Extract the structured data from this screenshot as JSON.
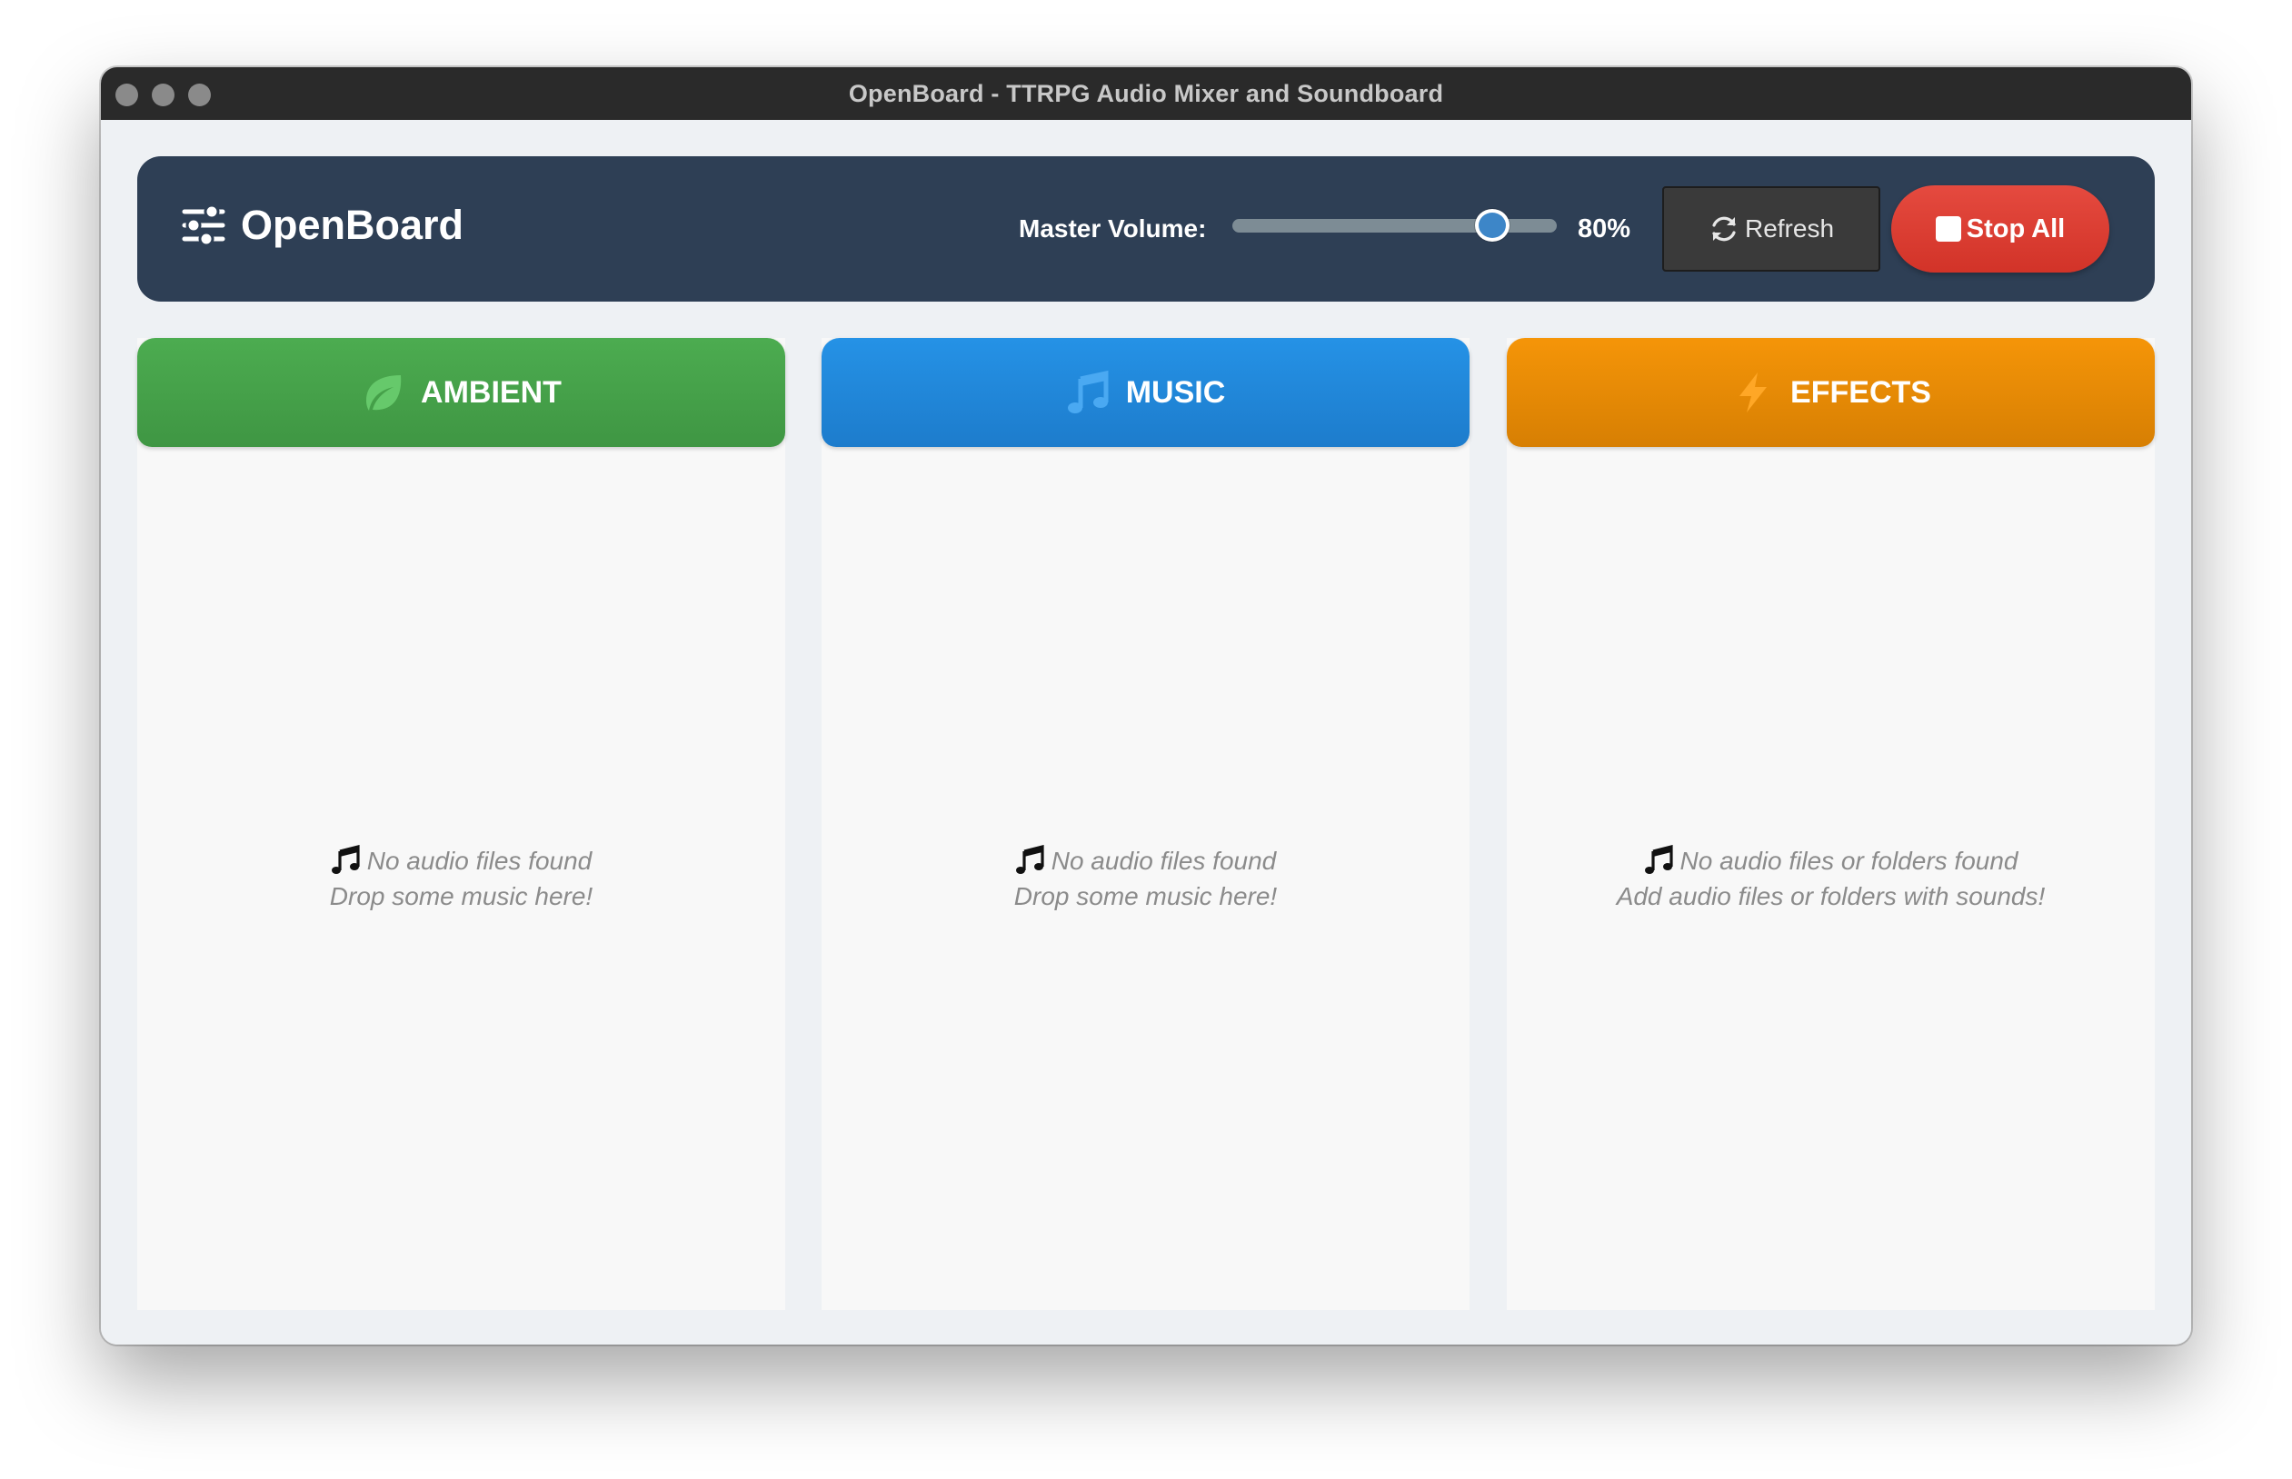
{
  "window": {
    "title": "OpenBoard - TTRPG Audio Mixer and Soundboard"
  },
  "header": {
    "brand": "OpenBoard",
    "brand_icon": "sliders-icon",
    "volume_label": "Master Volume:",
    "volume_value": "80%",
    "volume_level": 0.8,
    "refresh_label": "Refresh",
    "stop_label": "Stop All",
    "colors": {
      "header_bg": "#2e3f55",
      "stop": "#d9382d",
      "slider_thumb": "#3d86c8"
    }
  },
  "columns": [
    {
      "title": "AMBIENT",
      "icon": "leaf-icon",
      "color": "#43a047",
      "empty_line1": "No audio files found",
      "empty_line2": "Drop some music here!"
    },
    {
      "title": "MUSIC",
      "icon": "music-notes-icon",
      "color": "#1e88e5",
      "empty_line1": "No audio files found",
      "empty_line2": "Drop some music here!"
    },
    {
      "title": "EFFECTS",
      "icon": "lightning-icon",
      "color": "#fb8c00",
      "empty_line1": "No audio files or folders found",
      "empty_line2": "Add audio files or folders with sounds!"
    }
  ]
}
